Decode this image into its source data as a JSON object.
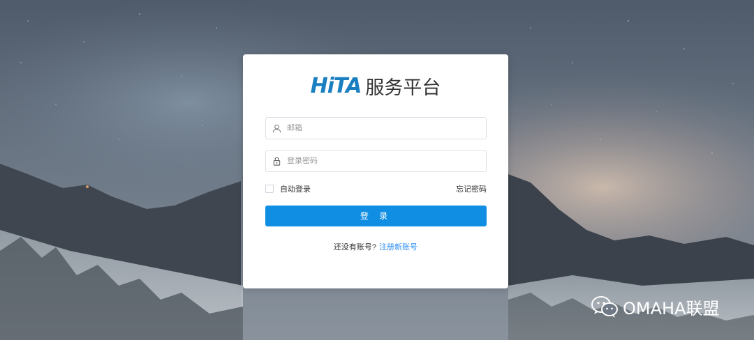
{
  "brand": {
    "logo_text": "HiTA",
    "name": "服务平台"
  },
  "form": {
    "email_placeholder": "邮箱",
    "email_value": "",
    "password_placeholder": "登录密码",
    "password_value": "",
    "remember_label": "自动登录",
    "remember_checked": false,
    "forgot_label": "忘记密码",
    "login_label": "登 录"
  },
  "register": {
    "prompt": "还没有账号?",
    "link": "注册新账号"
  },
  "watermark": {
    "text": "OMAHA联盟",
    "icon": "wechat-icon"
  },
  "colors": {
    "primary": "#0f8ee3",
    "brand": "#1a7fc1",
    "link": "#2d8ff0"
  },
  "icons": {
    "email": "user-icon",
    "password": "lock-icon"
  }
}
